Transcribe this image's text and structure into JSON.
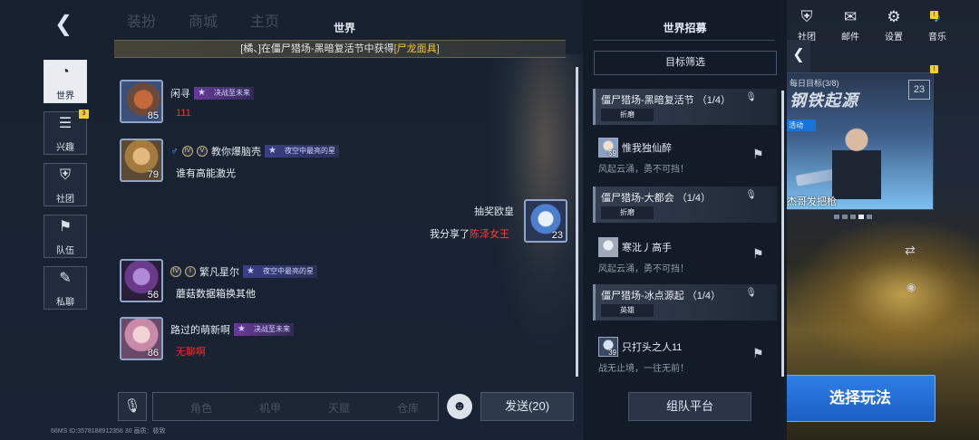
{
  "chat": {
    "title": "世界",
    "system_message": {
      "prefix": "[橘、]在僵尸猎场-黑暗复活节中获得",
      "item": "[尸龙面具]"
    },
    "ghost_top": [
      "装扮",
      "商城",
      "主页"
    ],
    "nav": [
      {
        "label": "世界",
        "icon": "globe-icon",
        "active": true,
        "badge": ""
      },
      {
        "label": "兴趣",
        "icon": "interest-icon",
        "active": false,
        "badge": "3"
      },
      {
        "label": "社团",
        "icon": "club-icon",
        "active": false,
        "badge": ""
      },
      {
        "label": "队伍",
        "icon": "flag-icon",
        "active": false,
        "badge": ""
      },
      {
        "label": "私聊",
        "icon": "chat-icon",
        "active": false,
        "badge": ""
      }
    ],
    "messages": [
      {
        "name": "闲寻",
        "title": "决战至未来",
        "level": "85",
        "text": "111",
        "text_red": true
      },
      {
        "name": "教你爆脑壳",
        "title": "夜空中最亮的星",
        "level": "79",
        "text": "谁有高能激光",
        "text_red": false
      },
      {
        "name": "抽奖欧皇",
        "title": "",
        "level": "23",
        "text_prefix": "我分享了",
        "text_highlight": "陈泽女王"
      },
      {
        "name": "繁凡星尔",
        "title": "夜空中最亮的星",
        "level": "56",
        "text": "蘑菇数据箱换其他",
        "text_red": false
      },
      {
        "name": "路过的萌新啊",
        "title": "决战至未来",
        "level": "86",
        "text": "无聊啊",
        "text_red": true
      }
    ],
    "ghost_input": [
      "角色",
      "机甲",
      "天赋",
      "仓库"
    ],
    "send_label": "发送(20)",
    "footer": "66MS  ID:3578188912356 30    画质：极致"
  },
  "recruit": {
    "title": "世界招募",
    "filter_label": "目标筛选",
    "entries": [
      {
        "title": "僵尸猎场-黑暗复活节 （1/4）",
        "difficulty": "折磨",
        "user": "惟我独仙醉",
        "level": "59",
        "slogan": "风起云涌，勇不可挡！"
      },
      {
        "title": "僵尸猎场-大都会 （1/4）",
        "difficulty": "折磨",
        "user": "寒沘丿高手",
        "level": "",
        "slogan": "风起云涌，勇不可挡！"
      },
      {
        "title": "僵尸猎场-冰点源起 （1/4）",
        "difficulty": "英雄",
        "user": "只打头之人11",
        "level": "39",
        "slogan": "战无止境，一往无前！"
      }
    ],
    "team_platform_label": "组队平台"
  },
  "topbar": [
    {
      "label": "社团",
      "icon": "club-icon"
    },
    {
      "label": "邮件",
      "icon": "mail-icon"
    },
    {
      "label": "设置",
      "icon": "gear-icon"
    },
    {
      "label": "音乐",
      "icon": "music-icon"
    }
  ],
  "event": {
    "progress": "每日目标(3/8)",
    "title_art": "钢铁起源",
    "badge_number": "23",
    "tag": "活动",
    "caption": "杰哥发把枪"
  },
  "select_mode_label": "选择玩法",
  "colors": {
    "accent": "#1c5fc5",
    "highlight_gold": "#f5c542",
    "alert_red": "#ff2a2a",
    "badge_yellow": "#f2cf2e"
  }
}
